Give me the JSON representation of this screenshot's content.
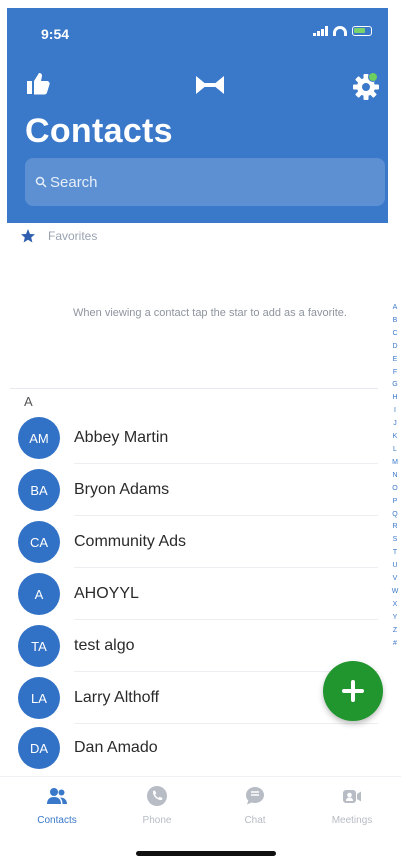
{
  "status_bar": {
    "time": "9:54"
  },
  "header": {
    "title": "Contacts"
  },
  "search": {
    "placeholder": "Search"
  },
  "favorites": {
    "label": "Favorites",
    "hint": "When viewing a contact tap the star to add as a favorite."
  },
  "section": {
    "letter": "A"
  },
  "contacts": [
    {
      "initials": "AM",
      "name": "Abbey Martin"
    },
    {
      "initials": "BA",
      "name": "Bryon Adams"
    },
    {
      "initials": "CA",
      "name": "Community Ads"
    },
    {
      "initials": "A",
      "name": "AHOYYL"
    },
    {
      "initials": "TA",
      "name": "test algo"
    },
    {
      "initials": "LA",
      "name": "Larry Althoff"
    },
    {
      "initials": "DA",
      "name": "Dan Amado"
    }
  ],
  "alpha_index": [
    "A",
    "B",
    "C",
    "D",
    "E",
    "F",
    "G",
    "H",
    "I",
    "J",
    "K",
    "L",
    "M",
    "N",
    "O",
    "P",
    "Q",
    "R",
    "S",
    "T",
    "U",
    "V",
    "W",
    "X",
    "Y",
    "Z",
    "#"
  ],
  "tabs": [
    {
      "label": "Contacts",
      "icon": "people-icon",
      "active": true
    },
    {
      "label": "Phone",
      "icon": "phone-icon",
      "active": false
    },
    {
      "label": "Chat",
      "icon": "chat-icon",
      "active": false
    },
    {
      "label": "Meetings",
      "icon": "video-icon",
      "active": false
    }
  ],
  "colors": {
    "header": "#3a78c9",
    "avatar": "#3272c6",
    "fab": "#21962f",
    "gear_badge": "#6ccf5e"
  }
}
